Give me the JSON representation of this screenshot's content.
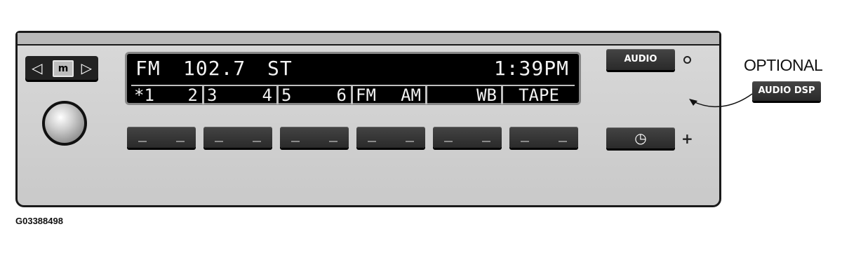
{
  "display": {
    "band": "FM",
    "frequency": "102.7",
    "stereo": "ST",
    "clock": "1:39PM",
    "presets": [
      {
        "left": "*1",
        "right": "2"
      },
      {
        "left": "3",
        "right": "4"
      },
      {
        "left": "5",
        "right": "6"
      }
    ],
    "band_fm": "FM",
    "band_am": "AM",
    "wb": "WB",
    "tape": "TAPE"
  },
  "controls": {
    "mode_key": "m",
    "left_arrow": "◁",
    "right_arrow": "▷",
    "audio_label": "AUDIO",
    "clock_glyph": "◷",
    "plus_glyph": "+",
    "preset_button_count": 6
  },
  "optional": {
    "label": "OPTIONAL",
    "button_label": "AUDIO DSP"
  },
  "figure_id": "G03388498",
  "colors": {
    "panel": "#cfcfcf",
    "display_bg": "#000000",
    "display_text": "#f2f2f2",
    "button": "#333333"
  }
}
